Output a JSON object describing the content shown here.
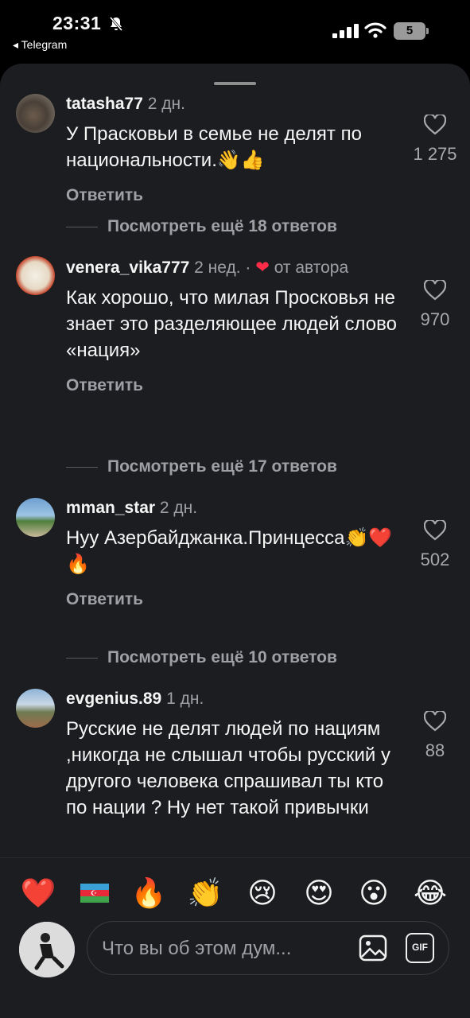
{
  "status_bar": {
    "time": "23:31",
    "back_app": "◂ Telegram",
    "battery": "5"
  },
  "comments": [
    {
      "username": "tatasha77",
      "age": "2 дн.",
      "meta_extra": "",
      "text": "У Прасковьи в семье не делят по национальности.👋👍",
      "likes": "1 275",
      "reply_label": "Ответить",
      "more_replies": "Посмотреть ещё 18 ответов"
    },
    {
      "username": "venera_vika777",
      "age": "2 нед. ·",
      "meta_extra": "от автора",
      "text": "Как хорошо, что милая Просковья не знает это разделяющее людей слово «нация»",
      "likes": "970",
      "reply_label": "Ответить",
      "more_replies": "Посмотреть ещё 17 ответов"
    },
    {
      "username": "mman_star",
      "age": "2 дн.",
      "meta_extra": "",
      "text": "Нуу Азербайджанка.Принцесса👏❤️🔥",
      "likes": "502",
      "reply_label": "Ответить",
      "more_replies": "Посмотреть ещё 10 ответов"
    },
    {
      "username": "evgenius.89",
      "age": "1 дн.",
      "meta_extra": "",
      "text": "Русские не делят людей по нациям ,никогда не слышал чтобы русский у другого человека спрашивал ты кто по нации ? Ну нет такой привычки",
      "likes": "88",
      "reply_label": "",
      "more_replies": ""
    }
  ],
  "quick_reactions": [
    "❤️",
    "🇦🇿",
    "🔥",
    "👏",
    "😢",
    "😍",
    "😮",
    "😂"
  ],
  "composer": {
    "placeholder": "Что вы об этом дум...",
    "gif_label": "GIF"
  },
  "colors": {
    "background": "#000000",
    "sheet": "#1c1d20",
    "muted_text": "#9ea0a5",
    "like_heart": "#ff2d48"
  }
}
